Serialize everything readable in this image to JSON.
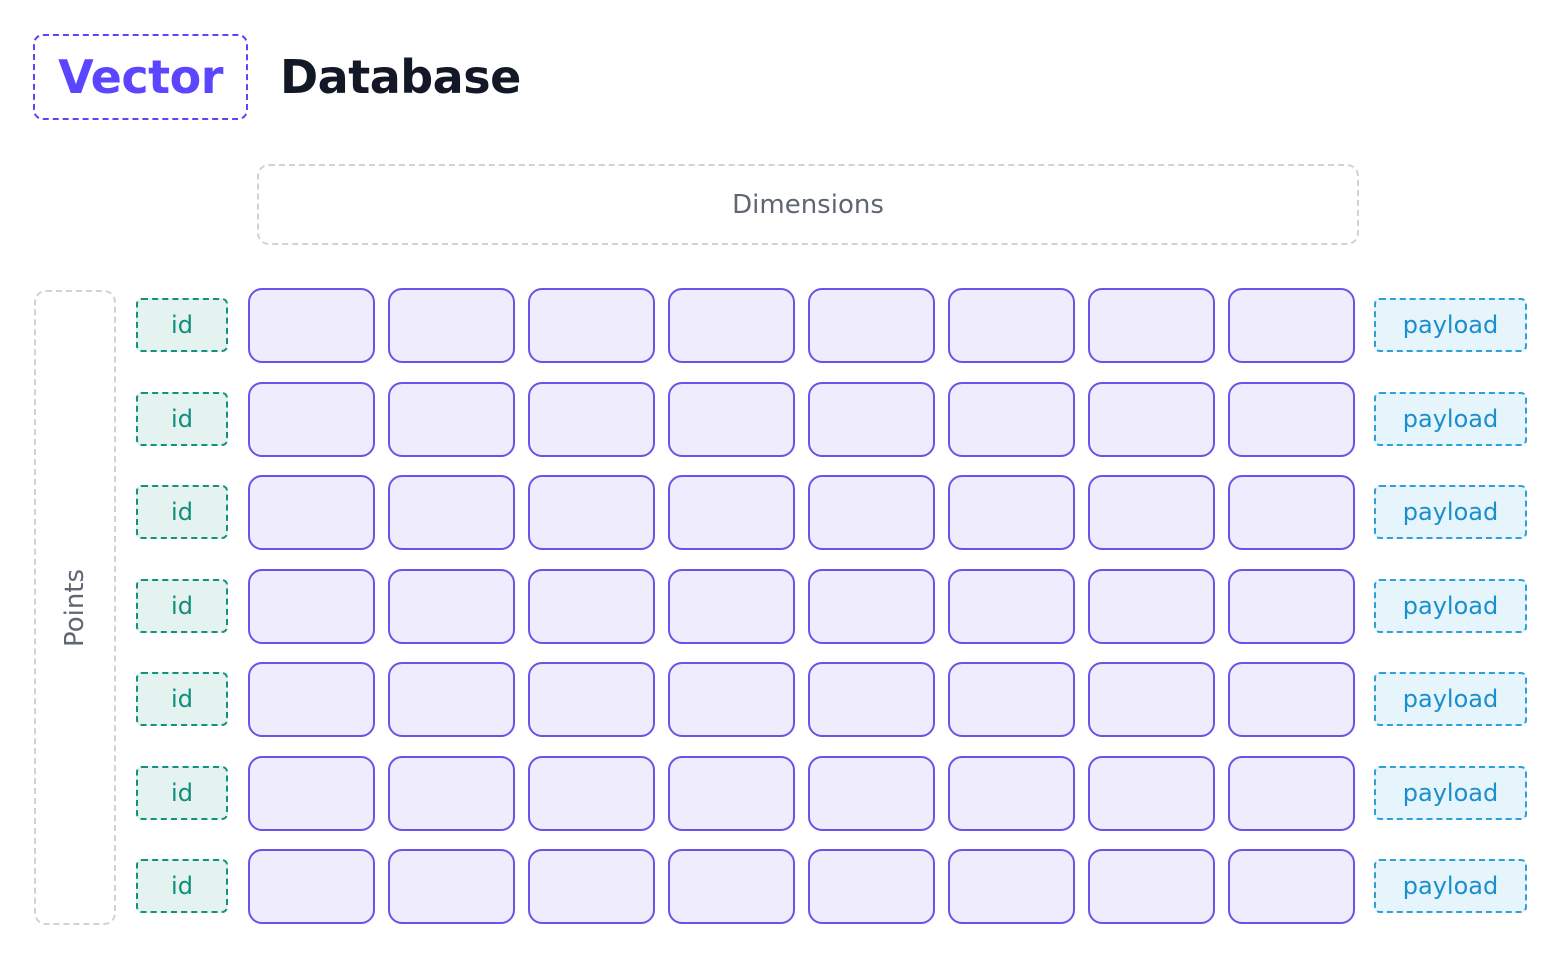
{
  "title": {
    "highlight": "Vector",
    "rest": "Database"
  },
  "labels": {
    "dimensions": "Dimensions",
    "points": "Points"
  },
  "row_labels": {
    "id": "id",
    "payload": "payload"
  },
  "grid": {
    "rows": 7,
    "dimensions_per_row": 8
  },
  "colors": {
    "accent": "#5b45ff",
    "vector_cell_border": "#6a53e8",
    "vector_cell_fill": "#efecfd",
    "id_color": "#0f8e7c",
    "id_fill": "#e4f3f0",
    "payload_color": "#1a8fcd",
    "payload_fill": "#e6f4fb",
    "dashed_gray": "#cfd2d6",
    "label_gray": "#5f6673"
  }
}
